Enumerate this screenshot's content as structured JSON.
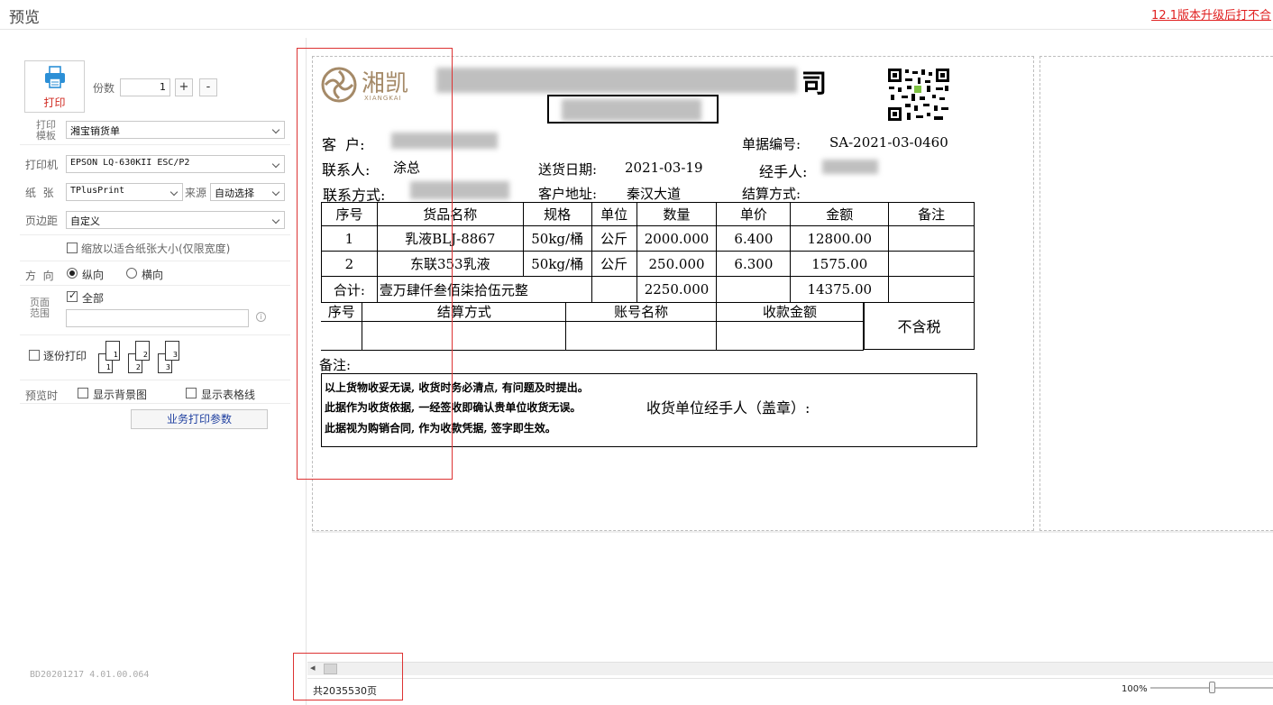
{
  "window": {
    "title": "预览",
    "notice": "12.1版本升级后打不合"
  },
  "print_panel": {
    "print_label": "打印",
    "copies_label": "份数",
    "copies_value": "1",
    "plus": "+",
    "minus": "-",
    "template_label": "打印\n模板",
    "template_value": "湘宝销货单",
    "printer_label": "打印机",
    "printer_value": "EPSON LQ-630KII ESC/P2",
    "paper_label": "纸  张",
    "paper_value": "TPlusPrint",
    "source_label": "来源",
    "source_value": "自动选择",
    "margin_label": "页边距",
    "margin_value": "自定义",
    "fit_label": "缩放以适合纸张大小(仅限宽度)",
    "orientation_label": "方  向",
    "portrait_label": "纵向",
    "landscape_label": "横向",
    "range_label": "页面\n范围",
    "range_all_label": "全部",
    "collate_label": "逐份打印",
    "preview_label": "预览时",
    "show_bg_label": "显示背景图",
    "show_grid_label": "显示表格线",
    "biz_params_label": "业务打印参数",
    "version": "BD20201217 4.01.00.064"
  },
  "document": {
    "logo_text": "湘凯",
    "logo_sub": "XIANGKAI",
    "company_suffix": "司",
    "customer_label": "客  户:",
    "doc_no_label": "单据编号:",
    "doc_no": "SA-2021-03-0460",
    "contact_label": "联系人:",
    "contact": "涂总",
    "delivery_date_label": "送货日期:",
    "delivery_date": "2021-03-19",
    "handler_label": "经手人:",
    "phone_label": "联系方式:",
    "address_label": "客户地址:",
    "address": "秦汉大道",
    "settlement_label": "结算方式:",
    "table_headers": [
      "序号",
      "货品名称",
      "规格",
      "单位",
      "数量",
      "单价",
      "金额",
      "备注"
    ],
    "rows": [
      [
        "1",
        "乳液BLJ-8867",
        "50kg/桶",
        "公斤",
        "2000.000",
        "6.400",
        "12800.00",
        ""
      ],
      [
        "2",
        "东联353乳液",
        "50kg/桶",
        "公斤",
        "250.000",
        "6.300",
        "1575.00",
        ""
      ]
    ],
    "total_label": "合计:",
    "total_words": "壹万肆仟叁佰柒拾伍元整",
    "total_qty": "2250.000",
    "total_amount": "14375.00",
    "pay_headers": [
      "序号",
      "结算方式",
      "账号名称",
      "收款金额"
    ],
    "tax_label": "不含税",
    "remark_label": "备注:",
    "notes": [
      "以上货物收妥无误, 收货时务必清点, 有问题及时提出。",
      "此据作为收货依据, 一经签收即确认贵单位收货无误。",
      "此据视为购销合同, 作为收款凭据, 签字即生效。"
    ],
    "sign_label": "收货单位经手人（盖章）:"
  },
  "status": {
    "page_count": "共2035530页",
    "zoom": "100%",
    "scroll_left": "◂"
  }
}
